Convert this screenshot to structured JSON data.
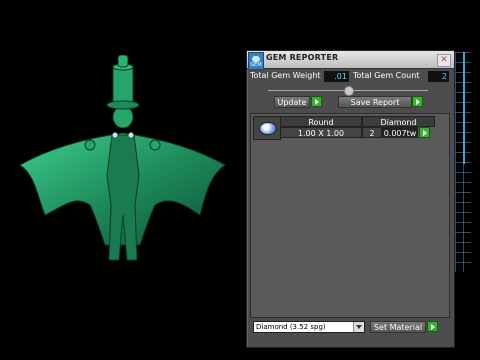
{
  "panel": {
    "title": "GEM REPORTER",
    "icon_text": "GEM",
    "close_glyph": "✕",
    "total_gem_weight_label": "Total Gem Weight",
    "total_gem_weight_value": ".01",
    "total_gem_count_label": "Total Gem Count",
    "total_gem_count_value": "2",
    "update_label": "Update",
    "save_report_label": "Save Report",
    "table": {
      "headers": [
        "Round",
        "Diamond"
      ],
      "row": {
        "size": "1.00 X 1.00",
        "quantity": "2",
        "weight": "0.007tw"
      }
    },
    "material_select": "Diamond   (3.52 spg)",
    "set_material_label": "Set Material"
  },
  "colors": {
    "pendant": "#1f8a5a",
    "panel_bg": "#4d4d4d",
    "value_text": "#5fd4ff",
    "go_button": "#38b030"
  },
  "icons": [
    "gem-reporter-app-icon",
    "close-icon",
    "play-arrow-icon",
    "gem-thumbnail-icon",
    "dropdown-arrow-icon"
  ]
}
